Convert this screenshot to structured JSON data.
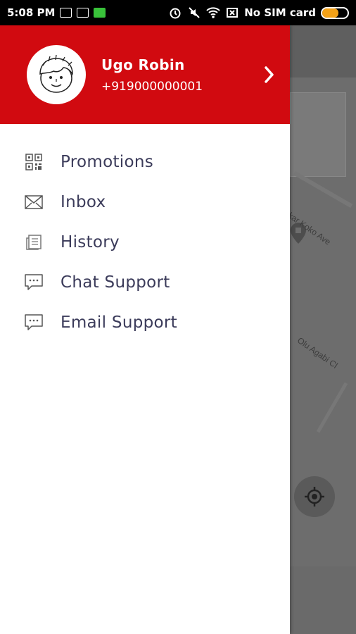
{
  "status_bar": {
    "time": "5:08 PM",
    "carrier": "No SIM card",
    "battery_level_percent": 65,
    "battery_color": "#f3a117",
    "notification_icons": [
      "notification-icon",
      "notification-icon",
      "app-icon"
    ],
    "system_icons": [
      "alarm-icon",
      "mute-icon",
      "wifi-icon",
      "no-sim-icon"
    ]
  },
  "drawer": {
    "header_color": "#d10a10",
    "user": {
      "name": "Ugo Robin",
      "phone": "+919000000001",
      "avatar_icon": "cartoon-avatar-icon"
    },
    "menu_items": [
      {
        "label": "Promotions",
        "icon": "qr-code-icon"
      },
      {
        "label": "Inbox",
        "icon": "envelope-icon"
      },
      {
        "label": "History",
        "icon": "history-icon"
      },
      {
        "label": "Chat Support",
        "icon": "chat-bubble-icon"
      },
      {
        "label": "Email Support",
        "icon": "chat-bubble-icon"
      }
    ]
  },
  "map": {
    "street_1": "hakar Koko Ave",
    "street_2": "Olu Agabi Cl",
    "locate_icon": "my-location-icon"
  }
}
